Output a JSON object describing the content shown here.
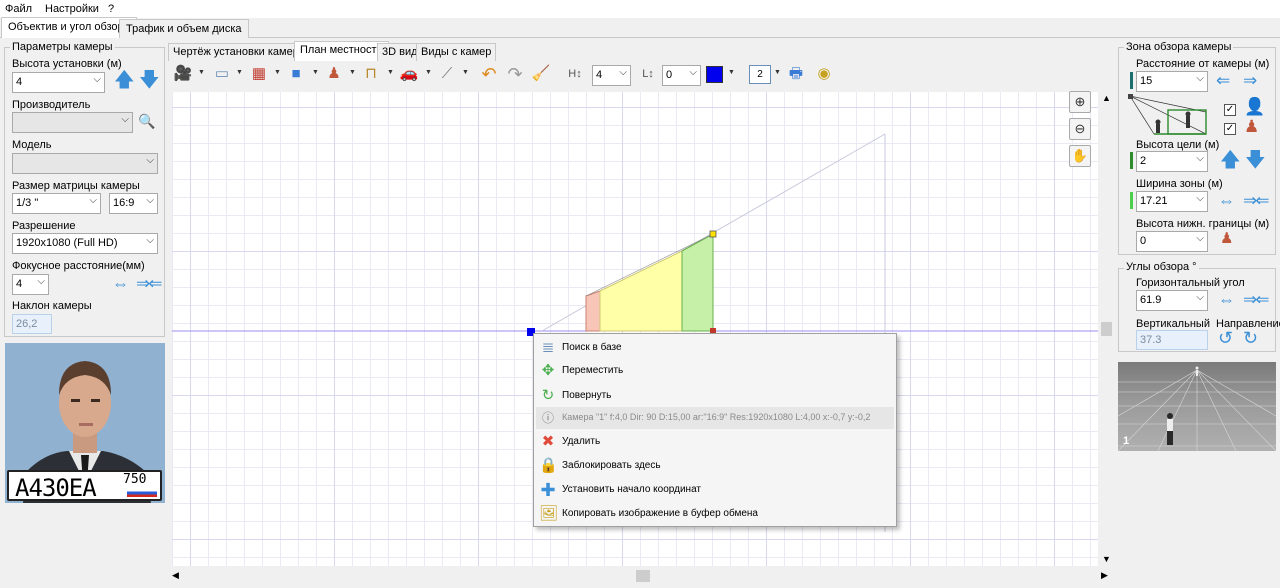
{
  "menu": {
    "file": "Файл",
    "settings": "Настройки",
    "help": "?"
  },
  "top_tabs": [
    "Объектив и угол обзора",
    "Трафик и объем диска"
  ],
  "camera_params": {
    "group_title": "Параметры камеры",
    "height_label": "Высота установки (м)",
    "height_value": "4",
    "manufacturer_label": "Производитель",
    "manufacturer_value": "",
    "model_label": "Модель",
    "model_value": "",
    "matrix_label": "Размер матрицы камеры",
    "matrix_value": "1/3 \"",
    "aspect_value": "16:9",
    "resolution_label": "Разрешение",
    "resolution_value": "1920x1080 (Full HD)",
    "focal_label": "Фокусное расстояние(мм)",
    "focal_value": "4",
    "tilt_label": "Наклон камеры",
    "tilt_value": "26,2"
  },
  "preview": {
    "plate_text": "A430EA",
    "plate_region": "750"
  },
  "view_tabs": [
    "Чертёж установки камеры",
    "План местности",
    "3D вид",
    "Виды с камер"
  ],
  "toolbar": {
    "height_field": "4",
    "level_field": "0",
    "page_num": "2"
  },
  "zone": {
    "group_title": "Зона обзора камеры",
    "distance_label": "Расстояние от камеры (м)",
    "distance_value": "15",
    "target_label": "Высота цели (м)",
    "target_value": "2",
    "width_label": "Ширина зоны (м)",
    "width_value": "17.21",
    "lower_label": "Высота нижн. границы (м)",
    "lower_value": "0"
  },
  "angles": {
    "group_title": "Углы обзора °",
    "h_label": "Горизонтальный угол",
    "h_value": "61.9",
    "v_label": "Вертикальный",
    "v_value": "37.3",
    "dir_label": "Направление"
  },
  "camera_view": {
    "index": "1"
  },
  "context_menu": [
    {
      "label": "Поиск в базе",
      "icon": "search-db-icon"
    },
    {
      "label": "Переместить",
      "icon": "move-icon"
    },
    {
      "label": "Повернуть",
      "icon": "rotate-icon"
    },
    {
      "label": "Камера \"1\" f:4,0 Dir: 90 D:15,00 ar:\"16:9\" Res:1920x1080 L:4,00 x:-0,7 y:-0,2",
      "icon": "info-icon"
    },
    {
      "label": "Удалить",
      "icon": "delete-icon"
    },
    {
      "label": "Заблокировать здесь",
      "icon": "lock-icon"
    },
    {
      "label": "Установить начало координат",
      "icon": "origin-icon"
    },
    {
      "label": "Копировать изображение в буфер обмена",
      "icon": "copy-image-icon"
    }
  ],
  "colors": {
    "accent": "#3b8fd6",
    "zone_yellow": "#ffffa8",
    "zone_green": "#c6efa8",
    "zone_red": "#f7c6b8"
  }
}
